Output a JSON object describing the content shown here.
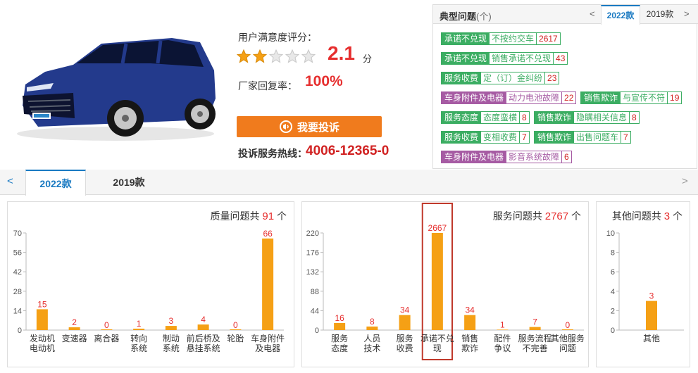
{
  "rating": {
    "label": "用户满意度评分：",
    "score": "2.1",
    "unit": "分",
    "stars_filled": 2,
    "stars_total": 5,
    "reply_label": "厂家回复率：",
    "reply_rate": "100%",
    "complain_button": "我要投诉",
    "hotline_label": "投诉服务热线：",
    "hotline": "4006-12365-0"
  },
  "typical": {
    "title": "典型问题",
    "title_suffix": "(个)",
    "prev": "<",
    "next": ">",
    "tabs": [
      {
        "label": "2022款",
        "active": true
      },
      {
        "label": "2019款",
        "active": false
      }
    ],
    "rows": [
      [
        {
          "k": "承诺不兑现",
          "v": "不按约交车",
          "n": "2617",
          "c": "g"
        }
      ],
      [
        {
          "k": "承诺不兑现",
          "v": "销售承诺不兑现",
          "n": "43",
          "c": "g"
        }
      ],
      [
        {
          "k": "服务收费",
          "v": "定（订）金纠纷",
          "n": "23",
          "c": "g"
        }
      ],
      [
        {
          "k": "车身附件及电器",
          "v": "动力电池故障",
          "n": "22",
          "c": "p"
        },
        {
          "k": "销售欺诈",
          "v": "与宣传不符",
          "n": "19",
          "c": "g"
        }
      ],
      [
        {
          "k": "服务态度",
          "v": "态度蛮横",
          "n": "8",
          "c": "g"
        },
        {
          "k": "销售欺诈",
          "v": "隐瞒相关信息",
          "n": "8",
          "c": "g"
        }
      ],
      [
        {
          "k": "服务收费",
          "v": "变相收费",
          "n": "7",
          "c": "g"
        },
        {
          "k": "销售欺诈",
          "v": "出售问题车",
          "n": "7",
          "c": "g"
        }
      ],
      [
        {
          "k": "车身附件及电器",
          "v": "影音系统故障",
          "n": "6",
          "c": "p"
        }
      ]
    ]
  },
  "year_bar": {
    "prev": "<",
    "next": ">",
    "tabs": [
      {
        "label": "2022款",
        "active": true
      },
      {
        "label": "2019款",
        "active": false
      }
    ]
  },
  "panels": [
    {
      "title_pre": "质量问题共",
      "total": "91",
      "title_post": "个"
    },
    {
      "title_pre": "服务问题共",
      "total": "2767",
      "title_post": "个"
    },
    {
      "title_pre": "其他问题共",
      "total": "3",
      "title_post": "个"
    }
  ],
  "colors": {
    "bar": "#f5a015",
    "value": "#e62e2e",
    "highlight": "#c0392b",
    "accent": "#f07b1d",
    "tab_active": "#1a7ac2"
  },
  "chart_data": [
    {
      "type": "bar",
      "categories": [
        "发动机\n电动机",
        "变速器",
        "离合器",
        "转向\n系统",
        "制动\n系统",
        "前后桥及\n悬挂系统",
        "轮胎",
        "车身附件\n及电器"
      ],
      "values": [
        15,
        2,
        0,
        1,
        3,
        4,
        0,
        66
      ],
      "yticks": [
        0,
        14,
        28,
        42,
        56,
        70
      ],
      "ylim": [
        0,
        70
      ]
    },
    {
      "type": "bar",
      "categories": [
        "服务\n态度",
        "人员\n技术",
        "服务\n收费",
        "承诺不兑\n现",
        "销售\n欺诈",
        "配件\n争议",
        "服务流程\n不完善",
        "其他服务\n问题"
      ],
      "values": [
        16,
        8,
        34,
        2667,
        34,
        1,
        7,
        0
      ],
      "yticks": [
        0,
        44,
        88,
        132,
        176,
        220
      ],
      "ylim": [
        0,
        220
      ],
      "highlight": 3
    },
    {
      "type": "bar",
      "categories": [
        "其他"
      ],
      "values": [
        3
      ],
      "yticks": [
        0,
        2,
        4,
        6,
        8,
        10
      ],
      "ylim": [
        0,
        10
      ]
    }
  ]
}
